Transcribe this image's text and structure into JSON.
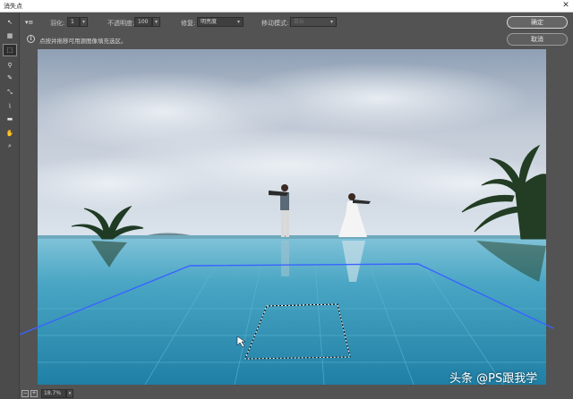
{
  "window": {
    "title": "消失点",
    "close_glyph": "✕"
  },
  "tools": [
    {
      "name": "edit-plane-icon",
      "glyph": "↖"
    },
    {
      "name": "create-plane-icon",
      "glyph": "▦"
    },
    {
      "name": "marquee-icon",
      "glyph": "⬚"
    },
    {
      "name": "stamp-icon",
      "glyph": "⚲"
    },
    {
      "name": "brush-icon",
      "glyph": "✎"
    },
    {
      "name": "transform-icon",
      "glyph": "⤡"
    },
    {
      "name": "eyedropper-icon",
      "glyph": "⌇"
    },
    {
      "name": "measure-icon",
      "glyph": "▬"
    },
    {
      "name": "hand-icon",
      "glyph": "✋"
    },
    {
      "name": "zoom-icon",
      "glyph": "⌕"
    }
  ],
  "options": {
    "plane_menu_glyph": "▾≡",
    "feather_label": "羽化:",
    "feather_value": "1",
    "opacity_label": "不透明度:",
    "opacity_value": "100",
    "heal_label": "修复:",
    "heal_value": "明亮度",
    "move_mode_label": "移动模式:",
    "move_mode_value": "目标",
    "dropdown_glyph": "▾"
  },
  "info": {
    "icon_glyph": "i",
    "text": "点按并拖移可用源图像填充选区。"
  },
  "buttons": {
    "ok": "确定",
    "cancel": "取消"
  },
  "status": {
    "zoom_out": "−",
    "zoom_in": "+",
    "zoom_value": "18.7%",
    "zoom_caret": "▾"
  },
  "watermark": "头条 @PS跟我学",
  "colors": {
    "plane_grid": "#3a63ff",
    "selection": "#ffffff"
  }
}
